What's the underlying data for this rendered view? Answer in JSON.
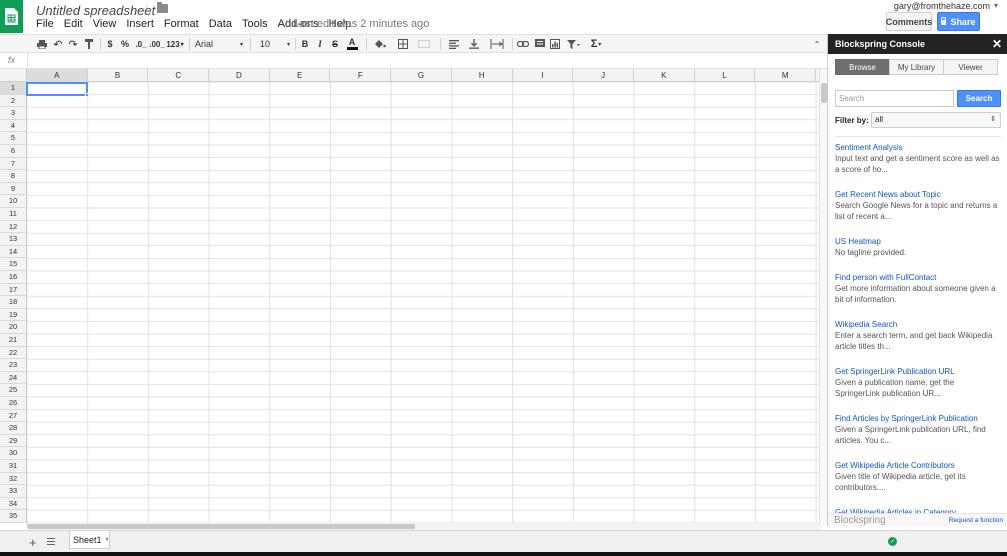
{
  "app": {
    "doc_title": "Untitled spreadsheet",
    "last_edit": "Last edit was 2 minutes ago",
    "user_email": "gary@fromthehaze.com",
    "comments_label": "Comments",
    "share_label": "Share",
    "brand_color": "#0f9d58"
  },
  "menu": [
    "File",
    "Edit",
    "View",
    "Insert",
    "Format",
    "Data",
    "Tools",
    "Add-ons",
    "Help"
  ],
  "toolbar": {
    "currency": "$",
    "percent": "%",
    "dec_less": ".0_",
    "dec_more": ".00_",
    "more_formats": "123",
    "font": "Arial",
    "font_size": "10",
    "bold": "B",
    "italic": "I",
    "strike": "S",
    "text_color": "A",
    "sum": "Σ"
  },
  "formula_bar": {
    "fx": "fx",
    "value": ""
  },
  "grid": {
    "columns": [
      "A",
      "B",
      "C",
      "D",
      "E",
      "F",
      "G",
      "H",
      "I",
      "J",
      "K",
      "L",
      "M"
    ],
    "rows": [
      "1",
      "2",
      "3",
      "4",
      "5",
      "6",
      "7",
      "8",
      "9",
      "10",
      "11",
      "12",
      "13",
      "14",
      "15",
      "16",
      "17",
      "18",
      "19",
      "20",
      "21",
      "22",
      "23",
      "24",
      "25",
      "26",
      "27",
      "28",
      "29",
      "30",
      "31",
      "32",
      "33",
      "34",
      "35"
    ],
    "selected_cell": "A1"
  },
  "sheets": {
    "add": "+",
    "active_tab": "Sheet1"
  },
  "panel": {
    "title": "Blockspring Console",
    "close": "✕",
    "tabs": [
      "Browse",
      "My Library",
      "Viewer"
    ],
    "active_tab": "Browse",
    "search_placeholder": "Search",
    "search_button": "Search",
    "filter_label": "Filter by:",
    "filter_value": "all",
    "results": [
      {
        "title": "Sentiment Analysis",
        "desc": "Input text and get a sentiment score as well as a score of ho..."
      },
      {
        "title": "Get Recent News about Topic",
        "desc": "Search Google News for a topic and returns a list of recent a..."
      },
      {
        "title": "US Heatmap",
        "desc": "No tagline provided."
      },
      {
        "title": "Find person with FullContact",
        "desc": "Get more information about someone given a bit of information."
      },
      {
        "title": "Wikipedia Search",
        "desc": "Enter a search term, and get back Wikipedia article titles th..."
      },
      {
        "title": "Get SpringerLink Publication URL",
        "desc": "Given a publication name, get the SpringerLink publication UR..."
      },
      {
        "title": "Find Articles by SpringerLink Publication",
        "desc": "Given a SpringerLink publication URL, find articles.  You c..."
      },
      {
        "title": "Get Wikipedia Article Contributors",
        "desc": "Given title of Wikipedia article, get its contributors...."
      },
      {
        "title": "Get Wikipedia Articles in Category",
        "desc": ""
      }
    ],
    "footer_brand": "Blockspring",
    "footer_link": "Request a function"
  },
  "status": {
    "ok_icon": "check-icon",
    "ok_glyph": "✓"
  }
}
